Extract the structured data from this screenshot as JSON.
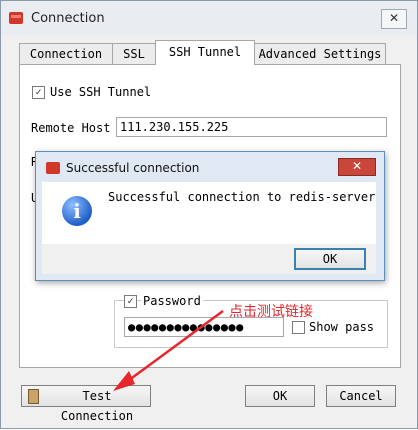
{
  "window": {
    "title": "Connection",
    "close_label": "✕"
  },
  "tabs": [
    {
      "label": "Connection"
    },
    {
      "label": "SSL"
    },
    {
      "label": "SSH Tunnel"
    },
    {
      "label": "Advanced Settings"
    }
  ],
  "ssh": {
    "use_ssh_label": "Use SSH Tunnel",
    "use_ssh_checked": "✓",
    "remote_host_label": "Remote Host",
    "remote_host_value": "111.230.155.225",
    "hidden_label_1": "R",
    "hidden_label_2": "U",
    "password_label": "Password",
    "password_checked": "✓",
    "password_value": "●●●●●●●●●●●●●●●",
    "show_pass_label": "Show pass"
  },
  "dialog": {
    "title": "Successful connection",
    "close_label": "✕",
    "message": "Successful connection to redis-server",
    "ok_label": "OK",
    "info_glyph": "i"
  },
  "annotation": {
    "text": "点击测试链接",
    "color": "#e8262b"
  },
  "footer": {
    "test_connection_label": "Test Connection",
    "ok_label": "OK",
    "cancel_label": "Cancel"
  }
}
